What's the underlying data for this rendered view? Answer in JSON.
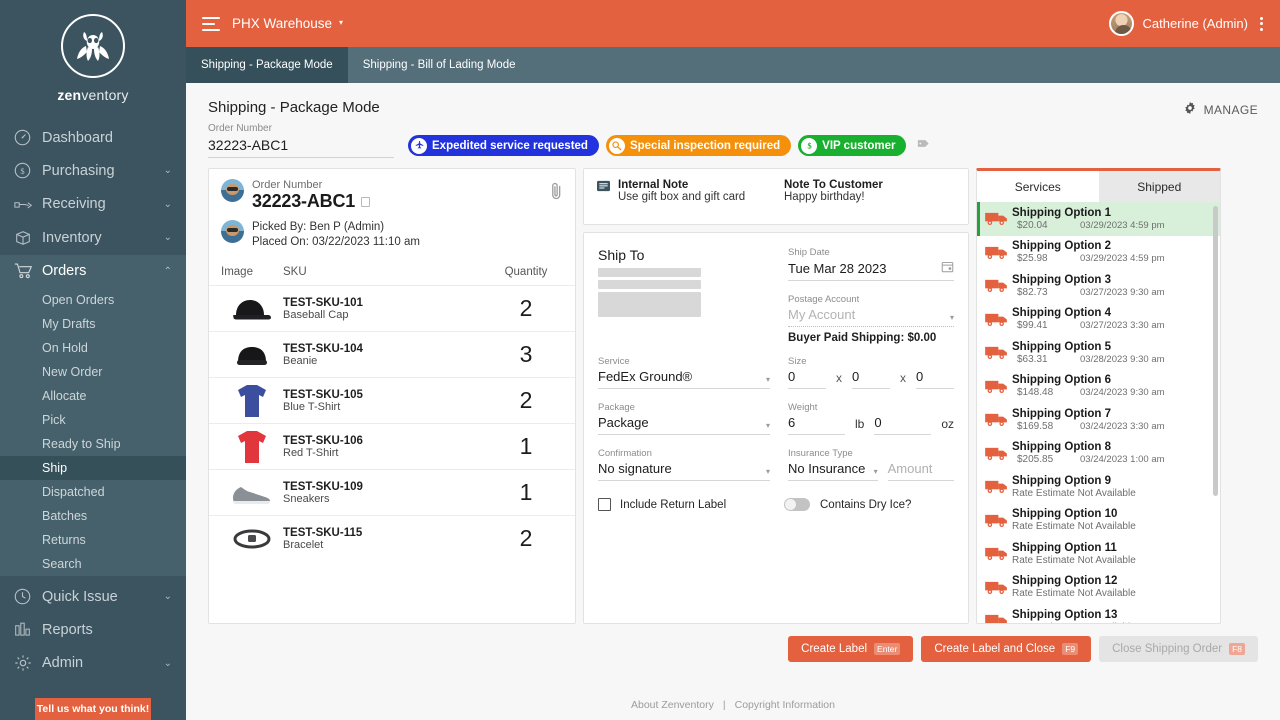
{
  "brand": {
    "name_bold": "zen",
    "name_light": "ventory",
    "accent": "#e4613f",
    "sidebar_bg": "#3c5460",
    "tabbar_bg": "#546e7a"
  },
  "sidebar": {
    "items": [
      {
        "label": "Dashboard",
        "icon": "dashboard-icon",
        "expandable": false
      },
      {
        "label": "Purchasing",
        "icon": "dollar-circle-icon",
        "expandable": true,
        "chevron": "⌄"
      },
      {
        "label": "Receiving",
        "icon": "hand-receive-icon",
        "expandable": true,
        "chevron": "⌄"
      },
      {
        "label": "Inventory",
        "icon": "box-icon",
        "expandable": true,
        "chevron": "⌄"
      },
      {
        "label": "Orders",
        "icon": "cart-icon",
        "expandable": true,
        "chevron": "⌃",
        "expanded": true
      }
    ],
    "orders_submenu": [
      {
        "label": "Open Orders",
        "active": false
      },
      {
        "label": "My Drafts",
        "active": false
      },
      {
        "label": "On Hold",
        "active": false
      },
      {
        "label": "New Order",
        "active": false
      },
      {
        "label": "Allocate",
        "active": false
      },
      {
        "label": "Pick",
        "active": false
      },
      {
        "label": "Ready to Ship",
        "active": false
      },
      {
        "label": "Ship",
        "active": true
      },
      {
        "label": "Dispatched",
        "active": false
      },
      {
        "label": "Batches",
        "active": false
      },
      {
        "label": "Returns",
        "active": false
      },
      {
        "label": "Search",
        "active": false
      }
    ],
    "bottom_items": [
      {
        "label": "Quick Issue",
        "icon": "clock-icon",
        "expandable": true,
        "chevron": "⌄"
      },
      {
        "label": "Reports",
        "icon": "bar-chart-icon",
        "expandable": false
      },
      {
        "label": "Admin",
        "icon": "gear-icon",
        "expandable": true,
        "chevron": "⌄"
      }
    ],
    "feedback_label": "Tell us what you think!"
  },
  "topbar": {
    "menu_icon": "hamburger-icon",
    "warehouse": "PHX Warehouse",
    "warehouse_caret": "▾",
    "user": "Catherine (Admin)",
    "kebab_icon": "more-vertical-icon"
  },
  "tabs": [
    {
      "label": "Shipping - Package Mode",
      "active": true
    },
    {
      "label": "Shipping - Bill of Lading Mode",
      "active": false
    }
  ],
  "page": {
    "title": "Shipping - Package Mode",
    "manage_label": "MANAGE",
    "order_number_label": "Order Number",
    "order_number_value": "32223-ABC1"
  },
  "badges": [
    {
      "label": "Expedited service requested",
      "color": "#2233dd",
      "icon": "airplane-icon",
      "glyph": "✈"
    },
    {
      "label": "Special inspection required",
      "color": "#f5900a",
      "icon": "magnifier-icon",
      "glyph": "⚲"
    },
    {
      "label": "VIP customer",
      "color": "#18b02e",
      "icon": "dollar-icon",
      "glyph": "$"
    }
  ],
  "order_card": {
    "order_number_label": "Order Number",
    "order_number": "32223-ABC1",
    "copy_icon": "copy-icon",
    "attachment_icon": "paperclip-icon",
    "picked_by": "Picked By: Ben P (Admin)",
    "placed_on": "Placed On: 03/22/2023 11:10 am",
    "columns": {
      "image": "Image",
      "sku": "SKU",
      "quantity": "Quantity"
    },
    "items": [
      {
        "sku": "TEST-SKU-101",
        "name": "Baseball Cap",
        "qty": "2",
        "img": "baseball-cap"
      },
      {
        "sku": "TEST-SKU-104",
        "name": "Beanie",
        "qty": "3",
        "img": "beanie"
      },
      {
        "sku": "TEST-SKU-105",
        "name": "Blue T-Shirt",
        "qty": "2",
        "img": "blue-tshirt"
      },
      {
        "sku": "TEST-SKU-106",
        "name": "Red T-Shirt",
        "qty": "1",
        "img": "red-tshirt"
      },
      {
        "sku": "TEST-SKU-109",
        "name": "Sneakers",
        "qty": "1",
        "img": "sneakers"
      },
      {
        "sku": "TEST-SKU-115",
        "name": "Bracelet",
        "qty": "2",
        "img": "bracelet"
      }
    ]
  },
  "notes": {
    "icon": "note-icon",
    "internal_title": "Internal Note",
    "internal_value": "Use gift box and gift card",
    "customer_title": "Note To Customer",
    "customer_value": "Happy birthday!"
  },
  "ship_form": {
    "ship_to_title": "Ship To",
    "ship_date_label": "Ship Date",
    "ship_date_value": "Tue Mar 28 2023",
    "calendar_icon": "calendar-icon",
    "postage_label": "Postage Account",
    "postage_placeholder": "My Account",
    "buyer_paid": "Buyer Paid Shipping: $0.00",
    "service_label": "Service",
    "service_value": "FedEx Ground®",
    "size_label": "Size",
    "size_l": "0",
    "size_w": "0",
    "size_h": "0",
    "size_sep": "x",
    "package_label": "Package",
    "package_value": "Package",
    "weight_label": "Weight",
    "weight_lb": "6",
    "weight_lb_unit": "lb",
    "weight_oz": "0",
    "weight_oz_unit": "oz",
    "confirmation_label": "Confirmation",
    "confirmation_value": "No signature",
    "insurance_label": "Insurance Type",
    "insurance_value": "No Insurance",
    "amount_placeholder": "Amount",
    "return_label": "Include Return Label",
    "dry_ice_label": "Contains Dry Ice?"
  },
  "services_panel": {
    "tabs": [
      {
        "label": "Services",
        "active": true
      },
      {
        "label": "Shipped",
        "active": false
      }
    ],
    "na_text": "Rate Estimate Not Available",
    "options": [
      {
        "name": "Shipping Option 1",
        "price": "$20.04",
        "date": "03/29/2023 4:59 pm",
        "selected": true
      },
      {
        "name": "Shipping Option 2",
        "price": "$25.98",
        "date": "03/29/2023 4:59 pm",
        "selected": false
      },
      {
        "name": "Shipping Option 3",
        "price": "$82.73",
        "date": "03/27/2023 9:30 am",
        "selected": false
      },
      {
        "name": "Shipping Option 4",
        "price": "$99.41",
        "date": "03/27/2023 3:30 am",
        "selected": false
      },
      {
        "name": "Shipping Option 5",
        "price": "$63.31",
        "date": "03/28/2023 9:30 am",
        "selected": false
      },
      {
        "name": "Shipping Option 6",
        "price": "$148.48",
        "date": "03/24/2023 9:30 am",
        "selected": false
      },
      {
        "name": "Shipping Option 7",
        "price": "$169.58",
        "date": "03/24/2023 3:30 am",
        "selected": false
      },
      {
        "name": "Shipping Option 8",
        "price": "$205.85",
        "date": "03/24/2023 1:00 am",
        "selected": false
      },
      {
        "name": "Shipping Option 9",
        "price": "",
        "date": "",
        "selected": false
      },
      {
        "name": "Shipping Option 10",
        "price": "",
        "date": "",
        "selected": false
      },
      {
        "name": "Shipping Option 11",
        "price": "",
        "date": "",
        "selected": false
      },
      {
        "name": "Shipping Option 12",
        "price": "",
        "date": "",
        "selected": false
      },
      {
        "name": "Shipping Option 13",
        "price": "",
        "date": "",
        "selected": false
      }
    ]
  },
  "actions": {
    "create_label": "Create Label",
    "create_key": "Enter",
    "create_close_label": "Create Label and Close",
    "create_close_key": "F9",
    "close_order_label": "Close Shipping Order",
    "close_order_key": "F8"
  },
  "footer": {
    "about": "About Zenventory",
    "divider": "|",
    "copyright": "Copyright Information"
  }
}
